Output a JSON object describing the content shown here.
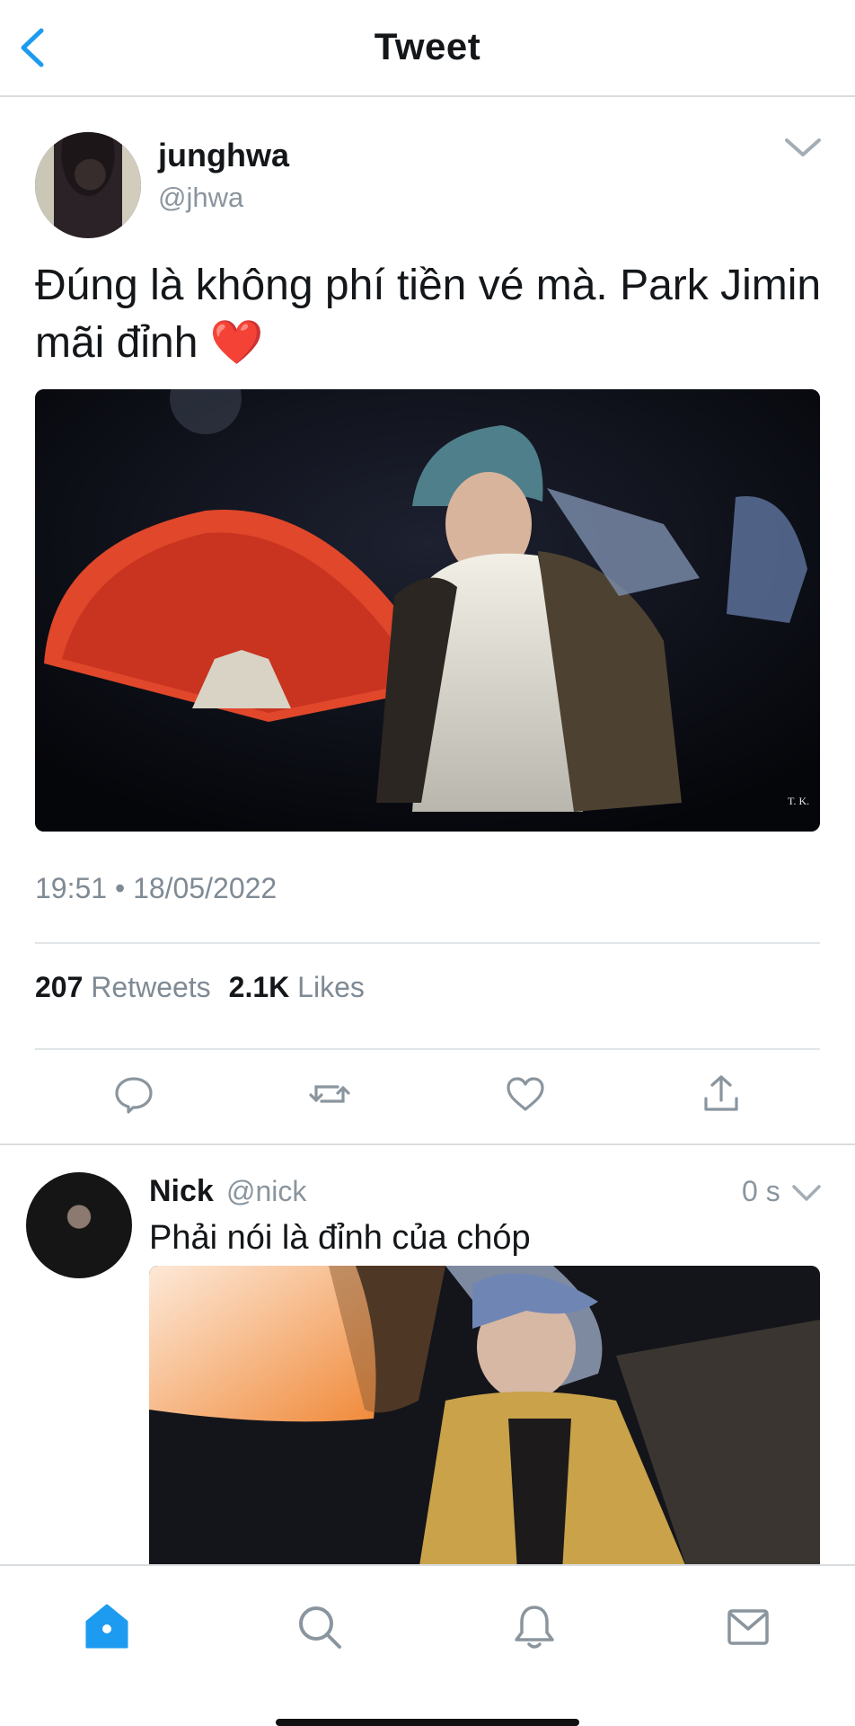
{
  "header": {
    "title": "Tweet"
  },
  "tweet": {
    "display_name": "junghwa",
    "handle": "@jhwa",
    "text": "Đúng là không phí tiền vé mà. Park Jimin mãi đỉnh ❤️",
    "timestamp": "19:51 • 18/05/2022",
    "retweets_count": "207",
    "retweets_label": "Retweets",
    "likes_count": "2.1K",
    "likes_label": "Likes",
    "media_watermark": "T. K."
  },
  "reply": {
    "display_name": "Nick",
    "handle": "@nick",
    "time": "0 s",
    "text": "Phải nói là đỉnh của chóp"
  },
  "icons": {
    "back": "chevron-left-icon",
    "more": "chevron-down-icon",
    "reply": "comment-icon",
    "retweet": "retweet-icon",
    "like": "heart-icon",
    "share": "share-icon",
    "home": "home-icon",
    "search": "search-icon",
    "notifications": "bell-icon",
    "messages": "mail-icon"
  },
  "colors": {
    "accent": "#1d9bf0",
    "icon_gray": "#8a959e",
    "text_gray": "#7f8a94",
    "heart_red": "#e0245e"
  }
}
